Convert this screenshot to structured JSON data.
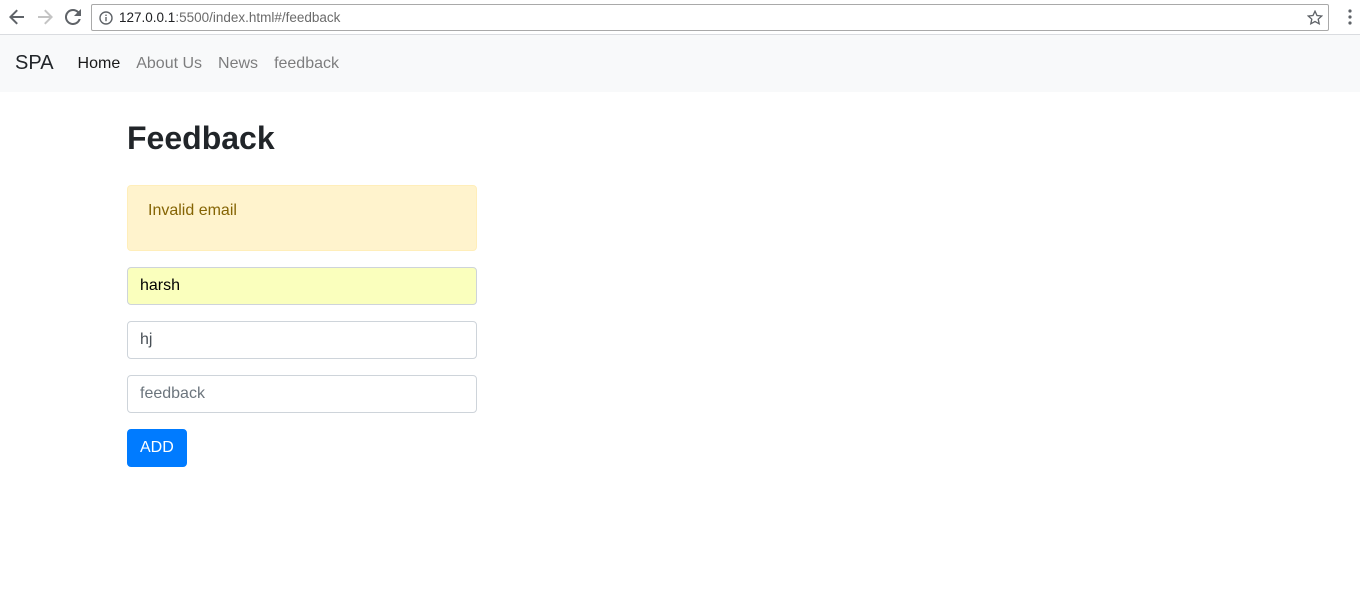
{
  "browser": {
    "url_host": "127.0.0.1",
    "url_rest": ":5500/index.html#/feedback",
    "icons": {
      "back": "back-arrow-icon",
      "forward": "forward-arrow-icon",
      "reload": "reload-icon",
      "info": "info-icon",
      "star": "bookmark-star-icon",
      "menu": "kebab-menu-icon"
    }
  },
  "navbar": {
    "brand": "SPA",
    "links": [
      {
        "label": "Home",
        "active": true
      },
      {
        "label": "About Us",
        "active": false
      },
      {
        "label": "News",
        "active": false
      },
      {
        "label": "feedback",
        "active": false
      }
    ]
  },
  "page": {
    "title": "Feedback",
    "alert_text": "Invalid email",
    "form": {
      "name_value": "harsh",
      "email_value": "hj",
      "feedback_placeholder": "feedback",
      "submit_label": "ADD"
    }
  },
  "colors": {
    "primary": "#007bff",
    "alert_bg": "#fff3cd",
    "alert_text": "#856404",
    "navbar_bg": "#f8f9fa"
  }
}
